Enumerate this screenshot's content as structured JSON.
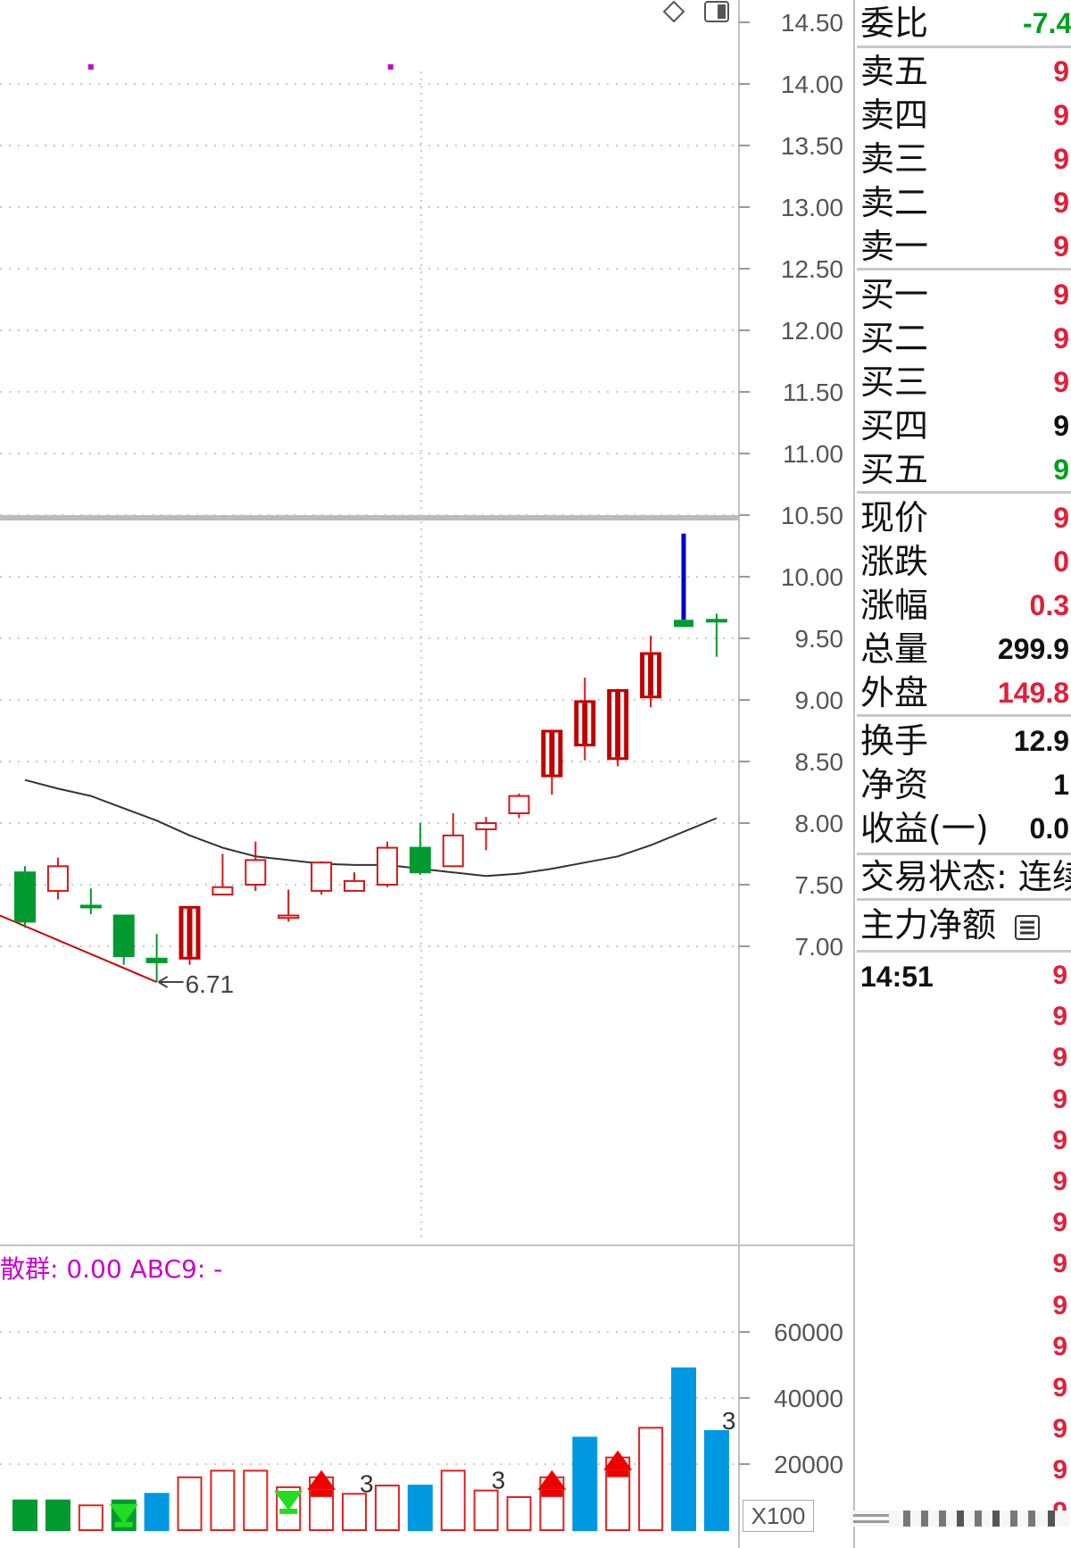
{
  "colors": {
    "up": "#cc0000",
    "down": "#009a2e",
    "blue": "#0098e0",
    "gray": "#555555",
    "magenta": "#cc00cc",
    "value_red": "#e0203a",
    "value_green": "#00a020"
  },
  "price_axis": {
    "labels": [
      "14.50",
      "14.00",
      "13.50",
      "13.00",
      "12.50",
      "12.00",
      "11.50",
      "11.00",
      "10.50",
      "10.00",
      "9.50",
      "9.00",
      "8.50",
      "8.00",
      "7.50",
      "7.00"
    ]
  },
  "volume_axis": {
    "labels": [
      "60000",
      "40000",
      "20000"
    ],
    "unit_button": "X100"
  },
  "low_marker": {
    "label": "6.71"
  },
  "indicator_label": "散群: 0.00 ABC9: -",
  "chart_data": {
    "type": "candlestick",
    "price_range": [
      7.0,
      14.5
    ],
    "candles": [
      {
        "o": 7.6,
        "c": 7.2,
        "h": 7.65,
        "l": 7.15
      },
      {
        "o": 7.45,
        "c": 7.65,
        "h": 7.72,
        "l": 7.38
      },
      {
        "o": 7.33,
        "c": 7.33,
        "h": 7.47,
        "l": 7.26
      },
      {
        "o": 7.25,
        "c": 6.92,
        "h": 7.25,
        "l": 6.85
      },
      {
        "o": 6.9,
        "c": 6.87,
        "h": 7.1,
        "l": 6.71
      },
      {
        "o": 6.9,
        "c": 7.32,
        "h": 7.32,
        "l": 6.85
      },
      {
        "o": 7.42,
        "c": 7.48,
        "h": 7.75,
        "l": 7.42
      },
      {
        "o": 7.5,
        "c": 7.7,
        "h": 7.85,
        "l": 7.45
      },
      {
        "o": 7.23,
        "c": 7.25,
        "h": 7.46,
        "l": 7.2
      },
      {
        "o": 7.45,
        "c": 7.68,
        "h": 7.69,
        "l": 7.42
      },
      {
        "o": 7.45,
        "c": 7.53,
        "h": 7.6,
        "l": 7.45
      },
      {
        "o": 7.5,
        "c": 7.8,
        "h": 7.85,
        "l": 7.48
      },
      {
        "o": 7.8,
        "c": 7.6,
        "h": 8.0,
        "l": 7.58
      },
      {
        "o": 7.65,
        "c": 7.9,
        "h": 8.08,
        "l": 7.65
      },
      {
        "o": 7.95,
        "c": 8.0,
        "h": 8.05,
        "l": 7.78
      },
      {
        "o": 8.08,
        "c": 8.22,
        "h": 8.24,
        "l": 8.04
      },
      {
        "o": 8.38,
        "c": 8.75,
        "h": 8.75,
        "l": 8.23
      },
      {
        "o": 8.63,
        "c": 8.99,
        "h": 9.18,
        "l": 8.51
      },
      {
        "o": 8.52,
        "c": 9.08,
        "h": 9.09,
        "l": 8.46
      },
      {
        "o": 9.02,
        "c": 9.38,
        "h": 9.52,
        "l": 8.94
      },
      {
        "o": 9.65,
        "c": 9.6,
        "h": 10.35,
        "l": 9.58
      },
      {
        "o": 9.65,
        "c": 9.65,
        "h": 9.7,
        "l": 9.35
      }
    ],
    "moving_average": [
      8.35,
      8.28,
      8.22,
      8.12,
      8.02,
      7.9,
      7.8,
      7.73,
      7.7,
      7.67,
      7.66,
      7.66,
      7.63,
      7.6,
      7.57,
      7.59,
      7.63,
      7.68,
      7.73,
      7.82,
      7.93,
      8.04
    ],
    "volume_range": [
      0,
      60000
    ],
    "volumes": [
      {
        "v": 9000,
        "fill": "down"
      },
      {
        "v": 9000,
        "fill": "down"
      },
      {
        "v": 7500,
        "fill": "hollow"
      },
      {
        "v": 9000,
        "fill": "down"
      },
      {
        "v": 11000,
        "fill": "blue"
      },
      {
        "v": 16000,
        "fill": "hollow"
      },
      {
        "v": 18000,
        "fill": "hollow"
      },
      {
        "v": 18000,
        "fill": "hollow"
      },
      {
        "v": 13000,
        "fill": "hollow"
      },
      {
        "v": 16000,
        "fill": "hollow"
      },
      {
        "v": 11000,
        "fill": "hollow"
      },
      {
        "v": 13500,
        "fill": "hollow"
      },
      {
        "v": 13500,
        "fill": "blue"
      },
      {
        "v": 18000,
        "fill": "hollow"
      },
      {
        "v": 12000,
        "fill": "hollow"
      },
      {
        "v": 10000,
        "fill": "hollow"
      },
      {
        "v": 16000,
        "fill": "hollow"
      },
      {
        "v": 28000,
        "fill": "blue"
      },
      {
        "v": 22000,
        "fill": "hollow"
      },
      {
        "v": 31000,
        "fill": "hollow"
      },
      {
        "v": 49000,
        "fill": "blue"
      },
      {
        "v": 30000,
        "fill": "blue"
      }
    ],
    "volume_labels": [
      {
        "index": 10,
        "text": "3"
      },
      {
        "index": 14,
        "text": "3"
      },
      {
        "index": 21,
        "text": "3"
      }
    ],
    "signals": [
      {
        "index": 3,
        "dir": "down"
      },
      {
        "index": 8,
        "dir": "down"
      },
      {
        "index": 9,
        "dir": "up"
      },
      {
        "index": 16,
        "dir": "up"
      },
      {
        "index": 18,
        "dir": "up"
      }
    ]
  },
  "side_panel": {
    "weibi": {
      "label": "委比",
      "value": "-7.4"
    },
    "sells": [
      {
        "label": "卖五",
        "value": "9"
      },
      {
        "label": "卖四",
        "value": "9"
      },
      {
        "label": "卖三",
        "value": "9"
      },
      {
        "label": "卖二",
        "value": "9"
      },
      {
        "label": "卖一",
        "value": "9"
      }
    ],
    "buys": [
      {
        "label": "买一",
        "value": "9"
      },
      {
        "label": "买二",
        "value": "9"
      },
      {
        "label": "买三",
        "value": "9"
      },
      {
        "label": "买四",
        "value": "9"
      },
      {
        "label": "买五",
        "value": "9"
      }
    ],
    "quote": [
      {
        "label": "现价",
        "value": "9",
        "color": "red"
      },
      {
        "label": "涨跌",
        "value": "0",
        "color": "red"
      },
      {
        "label": "涨幅",
        "value": "0.3",
        "color": "red"
      },
      {
        "label": "总量",
        "value": "299.9",
        "color": "black"
      },
      {
        "label": "外盘",
        "value": "149.8",
        "color": "red"
      }
    ],
    "stats": [
      {
        "label": "换手",
        "value": "12.9"
      },
      {
        "label": "净资",
        "value": "1"
      },
      {
        "label": "收益(一)",
        "value": "0.0"
      }
    ],
    "trade_status": "交易状态: 连续",
    "main_force_label": "主力净额",
    "tick_time": "14:51",
    "ticks": [
      "9",
      "9",
      "9",
      "9",
      "9",
      "9",
      "9",
      "9",
      "9",
      "9",
      "9",
      "9",
      "9",
      "9"
    ]
  }
}
